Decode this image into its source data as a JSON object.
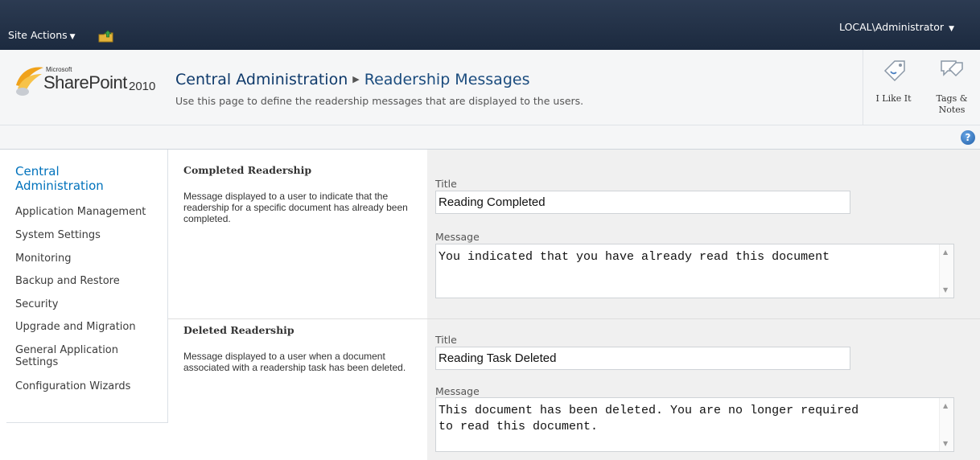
{
  "topbar": {
    "site_actions": "Site Actions",
    "user": "LOCAL\\Administrator"
  },
  "logo": {
    "microsoft": "Microsoft",
    "product": "SharePoint",
    "version": "2010"
  },
  "header": {
    "breadcrumb_root": "Central Administration",
    "breadcrumb_current": "Readership Messages",
    "description": "Use this page to define the readership messages that are displayed to the users."
  },
  "social": {
    "like": "I Like It",
    "tags_line1": "Tags &",
    "tags_line2": "Notes"
  },
  "help": {
    "label": "?"
  },
  "leftnav": {
    "heading_line1": "Central",
    "heading_line2": "Administration",
    "items": [
      "Application Management",
      "System Settings",
      "Monitoring",
      "Backup and Restore",
      "Security",
      "Upgrade and Migration",
      "General Application",
      "Settings",
      "Configuration Wizards"
    ]
  },
  "sections": [
    {
      "title": "Completed Readership",
      "description": "Message displayed to a user to indicate that the readership for a specific document has already been completed.",
      "title_label": "Title",
      "title_value": "Reading Completed",
      "message_label": "Message",
      "message_value": "You indicated that you have already read this document"
    },
    {
      "title": "Deleted Readership",
      "description": "Message displayed to a user when a document associated with a readership task has been deleted.",
      "title_label": "Title",
      "title_value": "Reading Task Deleted",
      "message_label": "Message",
      "message_value": "This document has been deleted. You are no longer required\nto read this document."
    }
  ],
  "colors": {
    "topbar": "#1c2a3f",
    "link": "#0072bc",
    "breadcrumb": "#0f3a6b"
  }
}
